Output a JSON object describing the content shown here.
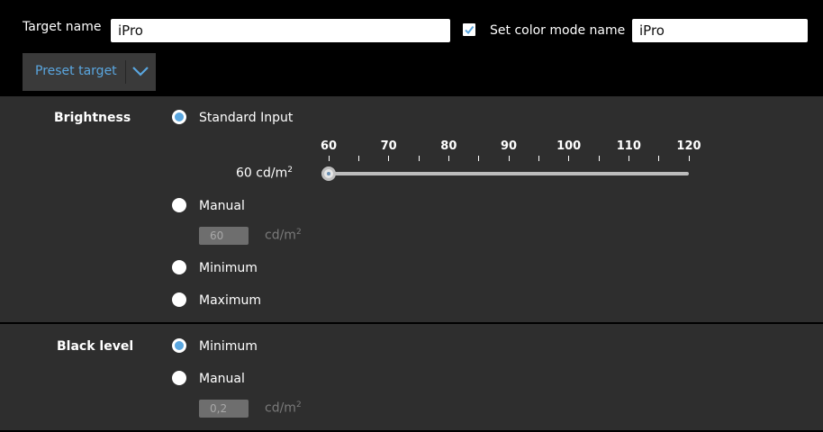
{
  "header": {
    "target_name_label": "Target name",
    "target_name_value": "iPro",
    "set_color_mode_checked": true,
    "set_color_mode_label": "Set color mode name",
    "color_mode_value": "iPro",
    "preset_button_label": "Preset target"
  },
  "brightness": {
    "title": "Brightness",
    "options": {
      "standard_input": "Standard Input",
      "manual": "Manual",
      "minimum": "Minimum",
      "maximum": "Maximum"
    },
    "selected": "standard_input",
    "slider": {
      "ticks": [
        "60",
        "70",
        "80",
        "90",
        "100",
        "110",
        "120"
      ],
      "min": 60,
      "max": 120,
      "value": 60,
      "value_label": "60 cd/m",
      "unit_sup": "2"
    },
    "manual_value": "60",
    "manual_unit": "cd/m",
    "manual_unit_sup": "2"
  },
  "black_level": {
    "title": "Black level",
    "options": {
      "minimum": "Minimum",
      "manual": "Manual"
    },
    "selected": "minimum",
    "manual_value": "0,2",
    "manual_unit": "cd/m",
    "manual_unit_sup": "2"
  },
  "colors": {
    "accent": "#5aa6df",
    "panel": "#2e2e2e",
    "background": "#000000"
  }
}
